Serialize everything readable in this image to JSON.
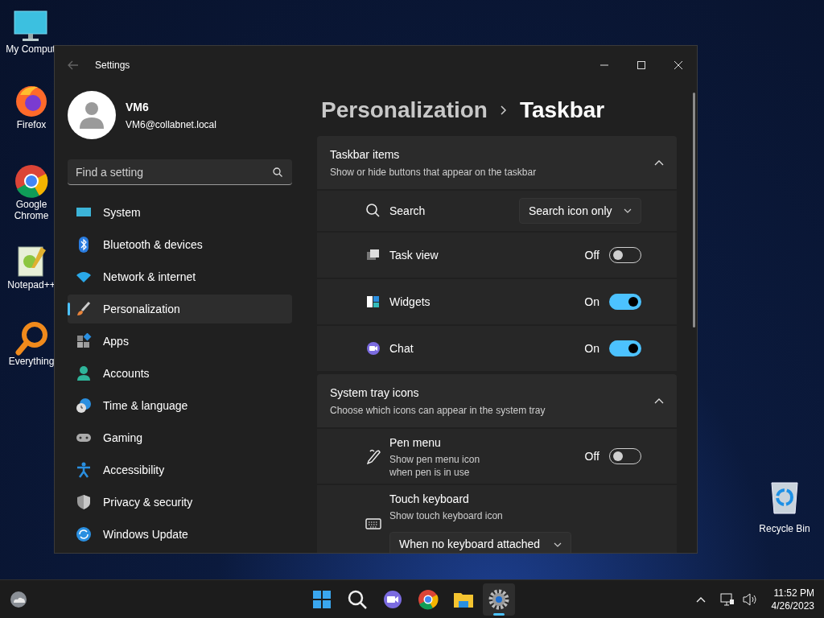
{
  "desktop_icons": [
    {
      "kind": "computer",
      "label": "My Comput"
    },
    {
      "kind": "firefox",
      "label": "Firefox"
    },
    {
      "kind": "chrome",
      "label": "Google Chrome"
    },
    {
      "kind": "notepad",
      "label": "Notepad++"
    },
    {
      "kind": "everything",
      "label": "Everything"
    },
    {
      "kind": "recycle",
      "label": "Recycle Bin"
    }
  ],
  "window": {
    "title": "Settings"
  },
  "user": {
    "name": "VM6",
    "email": "VM6@collabnet.local"
  },
  "search": {
    "placeholder": "Find a setting"
  },
  "nav_items": [
    {
      "kind": "system",
      "label": "System",
      "selected": false
    },
    {
      "kind": "bluetooth",
      "label": "Bluetooth & devices",
      "selected": false
    },
    {
      "kind": "network",
      "label": "Network & internet",
      "selected": false
    },
    {
      "kind": "personalization",
      "label": "Personalization",
      "selected": true
    },
    {
      "kind": "apps",
      "label": "Apps",
      "selected": false
    },
    {
      "kind": "accounts",
      "label": "Accounts",
      "selected": false
    },
    {
      "kind": "time",
      "label": "Time & language",
      "selected": false
    },
    {
      "kind": "gaming",
      "label": "Gaming",
      "selected": false
    },
    {
      "kind": "accessibility",
      "label": "Accessibility",
      "selected": false
    },
    {
      "kind": "privacy",
      "label": "Privacy & security",
      "selected": false
    },
    {
      "kind": "update",
      "label": "Windows Update",
      "selected": false
    }
  ],
  "breadcrumb": [
    "Personalization",
    "Taskbar"
  ],
  "sections": [
    {
      "title": "Taskbar items",
      "subtitle": "Show or hide buttons that appear on the taskbar",
      "expanded": true,
      "rows": [
        {
          "kind": "dropdown",
          "label": "Search",
          "value": "Search icon only"
        },
        {
          "kind": "toggle",
          "label": "Task view",
          "state_label": "Off",
          "on": false
        },
        {
          "kind": "toggle",
          "label": "Widgets",
          "state_label": "On",
          "on": true
        },
        {
          "kind": "toggle",
          "label": "Chat",
          "state_label": "On",
          "on": true
        }
      ]
    },
    {
      "title": "System tray icons",
      "subtitle": "Choose which icons can appear in the system tray",
      "expanded": true,
      "rows": [
        {
          "kind": "toggle",
          "label": "Pen menu",
          "description": "Show pen menu icon when pen is in use",
          "state_label": "Off",
          "on": false
        },
        {
          "kind": "dropdown_below",
          "label": "Touch keyboard",
          "description": "Show touch keyboard icon",
          "value": "When no keyboard attached"
        }
      ]
    }
  ],
  "taskbar": {
    "apps": [
      {
        "kind": "start",
        "selected": false
      },
      {
        "kind": "search",
        "selected": false
      },
      {
        "kind": "chat",
        "selected": false
      },
      {
        "kind": "chrome",
        "selected": false
      },
      {
        "kind": "explorer",
        "selected": false
      },
      {
        "kind": "settings",
        "selected": true
      }
    ],
    "time": "11:52 PM",
    "date": "4/26/2023"
  }
}
